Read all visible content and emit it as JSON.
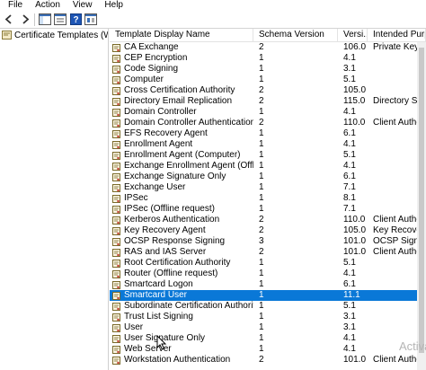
{
  "menubar": {
    "items": [
      "File",
      "Action",
      "View",
      "Help"
    ]
  },
  "toolbar": {
    "buttons": [
      {
        "name": "back-icon"
      },
      {
        "name": "forward-icon"
      },
      {
        "name": "show-hide-tree-icon"
      },
      {
        "name": "export-list-icon"
      },
      {
        "name": "help-icon"
      },
      {
        "name": "properties-icon"
      }
    ]
  },
  "tree": {
    "root_label": "Certificate Templates (WIN-ODE"
  },
  "list": {
    "columns": [
      "Template Display Name",
      "Schema Version",
      "Versi...",
      "Intended Purpose"
    ],
    "selected_index": 23,
    "rows": [
      {
        "name": "CA Exchange",
        "schema": "2",
        "version": "106.0",
        "purpose": "Private Key Archival"
      },
      {
        "name": "CEP Encryption",
        "schema": "1",
        "version": "4.1",
        "purpose": ""
      },
      {
        "name": "Code Signing",
        "schema": "1",
        "version": "3.1",
        "purpose": ""
      },
      {
        "name": "Computer",
        "schema": "1",
        "version": "5.1",
        "purpose": ""
      },
      {
        "name": "Cross Certification Authority",
        "schema": "2",
        "version": "105.0",
        "purpose": ""
      },
      {
        "name": "Directory Email Replication",
        "schema": "2",
        "version": "115.0",
        "purpose": "Directory Service Email Replication"
      },
      {
        "name": "Domain Controller",
        "schema": "1",
        "version": "4.1",
        "purpose": ""
      },
      {
        "name": "Domain Controller Authentication",
        "schema": "2",
        "version": "110.0",
        "purpose": "Client Authentication"
      },
      {
        "name": "EFS Recovery Agent",
        "schema": "1",
        "version": "6.1",
        "purpose": ""
      },
      {
        "name": "Enrollment Agent",
        "schema": "1",
        "version": "4.1",
        "purpose": ""
      },
      {
        "name": "Enrollment Agent (Computer)",
        "schema": "1",
        "version": "5.1",
        "purpose": ""
      },
      {
        "name": "Exchange Enrollment Agent (Offline request)",
        "schema": "1",
        "version": "4.1",
        "purpose": ""
      },
      {
        "name": "Exchange Signature Only",
        "schema": "1",
        "version": "6.1",
        "purpose": ""
      },
      {
        "name": "Exchange User",
        "schema": "1",
        "version": "7.1",
        "purpose": ""
      },
      {
        "name": "IPSec",
        "schema": "1",
        "version": "8.1",
        "purpose": ""
      },
      {
        "name": "IPSec (Offline request)",
        "schema": "1",
        "version": "7.1",
        "purpose": ""
      },
      {
        "name": "Kerberos Authentication",
        "schema": "2",
        "version": "110.0",
        "purpose": "Client Authentication"
      },
      {
        "name": "Key Recovery Agent",
        "schema": "2",
        "version": "105.0",
        "purpose": "Key Recovery Agent"
      },
      {
        "name": "OCSP Response Signing",
        "schema": "3",
        "version": "101.0",
        "purpose": "OCSP Signing"
      },
      {
        "name": "RAS and IAS Server",
        "schema": "2",
        "version": "101.0",
        "purpose": "Client Authentication"
      },
      {
        "name": "Root Certification Authority",
        "schema": "1",
        "version": "5.1",
        "purpose": ""
      },
      {
        "name": "Router (Offline request)",
        "schema": "1",
        "version": "4.1",
        "purpose": ""
      },
      {
        "name": "Smartcard Logon",
        "schema": "1",
        "version": "6.1",
        "purpose": ""
      },
      {
        "name": "Smartcard User",
        "schema": "1",
        "version": "11.1",
        "purpose": ""
      },
      {
        "name": "Subordinate Certification Authority",
        "schema": "1",
        "version": "5.1",
        "purpose": ""
      },
      {
        "name": "Trust List Signing",
        "schema": "1",
        "version": "3.1",
        "purpose": ""
      },
      {
        "name": "User",
        "schema": "1",
        "version": "3.1",
        "purpose": ""
      },
      {
        "name": "User Signature Only",
        "schema": "1",
        "version": "4.1",
        "purpose": ""
      },
      {
        "name": "Web Server",
        "schema": "1",
        "version": "4.1",
        "purpose": ""
      },
      {
        "name": "Workstation Authentication",
        "schema": "2",
        "version": "101.0",
        "purpose": "Client Authentication"
      }
    ]
  },
  "watermark": "Activate",
  "colors": {
    "selection": "#0a78d7",
    "selection_text": "#ffffff"
  }
}
